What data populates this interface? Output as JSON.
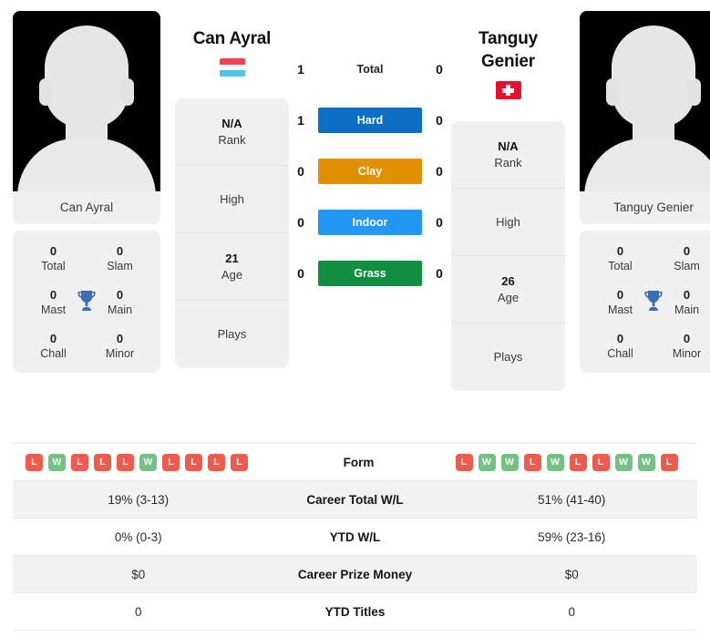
{
  "players": {
    "left": {
      "name": "Can Ayral",
      "photo_caption": "Can Ayral",
      "flag": "luxembourg-flag",
      "rank_value": "N/A",
      "rank_label": "Rank",
      "high_label": "High",
      "age_value": "21",
      "age_label": "Age",
      "plays_label": "Plays",
      "titles": [
        {
          "num": "0",
          "label": "Total"
        },
        {
          "num": "0",
          "label": "Slam"
        },
        {
          "num": "0",
          "label": "Mast"
        },
        {
          "num": "0",
          "label": "Main"
        },
        {
          "num": "0",
          "label": "Chall"
        },
        {
          "num": "0",
          "label": "Minor"
        }
      ]
    },
    "right": {
      "name": "Tanguy Genier",
      "name_line1": "Tanguy",
      "name_line2": "Genier",
      "photo_caption": "Tanguy Genier",
      "flag": "switzerland-flag",
      "rank_value": "N/A",
      "rank_label": "Rank",
      "high_label": "High",
      "age_value": "26",
      "age_label": "Age",
      "plays_label": "Plays",
      "titles": [
        {
          "num": "0",
          "label": "Total"
        },
        {
          "num": "0",
          "label": "Slam"
        },
        {
          "num": "0",
          "label": "Mast"
        },
        {
          "num": "0",
          "label": "Main"
        },
        {
          "num": "0",
          "label": "Chall"
        },
        {
          "num": "0",
          "label": "Minor"
        }
      ]
    }
  },
  "h2h": [
    {
      "label": "Total",
      "left": "1",
      "right": "0",
      "color": "",
      "chip": false
    },
    {
      "label": "Hard",
      "left": "1",
      "right": "0",
      "color": "#0b6fc4",
      "chip": true
    },
    {
      "label": "Clay",
      "left": "0",
      "right": "0",
      "color": "#e09000",
      "chip": true
    },
    {
      "label": "Indoor",
      "left": "0",
      "right": "0",
      "color": "#2196f3",
      "chip": true
    },
    {
      "label": "Grass",
      "left": "0",
      "right": "0",
      "color": "#119042",
      "chip": true
    }
  ],
  "stats_table": [
    {
      "label": "Form",
      "type": "form",
      "left_form": [
        "L",
        "W",
        "L",
        "L",
        "L",
        "W",
        "L",
        "L",
        "L",
        "L"
      ],
      "right_form": [
        "L",
        "W",
        "W",
        "L",
        "W",
        "L",
        "L",
        "W",
        "W",
        "L"
      ],
      "shaded": false
    },
    {
      "label": "Career Total W/L",
      "type": "text",
      "left": "19% (3-13)",
      "right": "51% (41-40)",
      "shaded": true
    },
    {
      "label": "YTD W/L",
      "type": "text",
      "left": "0% (0-3)",
      "right": "59% (23-16)",
      "shaded": false
    },
    {
      "label": "Career Prize Money",
      "type": "text",
      "left": "$0",
      "right": "$0",
      "shaded": true
    },
    {
      "label": "YTD Titles",
      "type": "text",
      "left": "0",
      "right": "0",
      "shaded": false
    }
  ],
  "colors": {
    "win": "#73c283",
    "loss": "#ef5b4c",
    "trophy": "#3c6cb4",
    "panel": "#f0f0f0",
    "row_alt": "#f2f2f2"
  }
}
